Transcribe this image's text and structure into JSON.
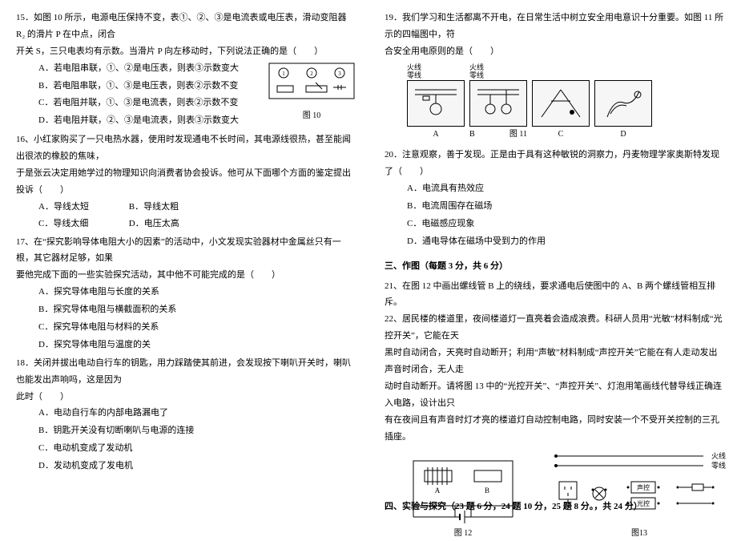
{
  "left": {
    "q15": {
      "stem1": "15．如图 10 所示，电源电压保持不变，表①、②、③是电流表或电压表，滑动变阻器 R₂ 的滑片 P 在中点，闭合",
      "stem2": "开关 S，三只电表均有示数。当滑片 P 向左移动时，下列说法正确的是（　　）",
      "A": "A．若电阻串联，①、②是电压表，则表③示数变大",
      "B": "B．若电阻串联，①、③是电压表，则表②示数不变",
      "C": "C．若电阻并联，①、③是电流表，则表②示数不变",
      "D": "D．若电阻并联，②、③是电流表，则表③示数变大",
      "figcap": "图 10"
    },
    "q16": {
      "stem1": "16、小红家购买了一只电热水器，使用时发现通电不长时间，其电源线很热，甚至能闻出很浓的橡胶的焦味，",
      "stem2": "于是张云决定用她学过的物理知识向消费者协会投诉。他可从下面哪个方面的鉴定提出投诉（　　）",
      "A": "A．导线太短",
      "B": "B．导线太粗",
      "C": "C．导线太细",
      "D": "D．电压太高"
    },
    "q17": {
      "stem1": "17、在“探究影响导体电阻大小的因素”的活动中，小文发现实验器材中金属丝只有一根，其它器材足够，如果",
      "stem2": "要他完成下面的一些实验探究活动，其中他不可能完成的是（　　）",
      "A": "A．探究导体电阻与长度的关系",
      "B": "B．探究导体电阻与横截面积的关系",
      "C": "C．探究导体电阻与材料的关系",
      "D": "D．探究导体电阻与温度的关"
    },
    "q18": {
      "stem1": "18．关闭并拔出电动自行车的钥匙，用力踩踏使其前进，会发现按下喇叭开关时，喇叭也能发出声响吗，这是因为",
      "stem2": "此时（　　）",
      "A": "A．电动自行车的内部电路漏电了",
      "B": "B．钥匙开关没有切断喇叭与电源的连接",
      "C": "C．电动机变成了发动机",
      "D": "D．发动机变成了发电机"
    }
  },
  "right": {
    "q19": {
      "stem1": "19．我们学习和生活都离不开电，在日常生活中树立安全用电意识十分重要。如图 11 所示的四幅图中，符",
      "stem2": "合安全用电原则的是（　　）",
      "labelA": "A",
      "labelB": "B",
      "labelC": "C",
      "labelD": "D",
      "wire1": "火线",
      "wire2": "零线",
      "figcap": "图 11"
    },
    "q20": {
      "stem": "20．注意观察，善于发现。正是由于具有这种敏锐的洞察力，丹麦物理学家奥斯特发现了（　　）",
      "A": "A．电流具有热效应",
      "B": "B．电流周围存在磁场",
      "C": "C．电磁感应现象",
      "D": "D．通电导体在磁场中受到力的作用"
    },
    "section3": {
      "title": "三、作图（每题 3 分，共 6 分）",
      "q21": "21、在图 12 中画出螺线管 B 上的绕线，要求通电后使图中的 A、B 两个螺线管相互排斥。",
      "q22a": "22、居民楼的楼道里，夜间楼道灯一直亮着会造成浪费。科研人员用“光敏”材料制成“光控开关”，它能在天",
      "q22b": "黑时自动闭合，天亮时自动断开；利用“声敏”材料制成“声控开关”它能在有人走动发出声音时闭合，无人走",
      "q22c": "动时自动断开。请将图 13 中的“光控开关”、“声控开关”、灯泡用笔画线代替导线正确连入电路，设计出只",
      "q22d": "有在夜间且有声音时灯才亮的楼道灯自动控制电路，同时安装一个不受开关控制的三孔插座。",
      "fig12cap": "图 12",
      "fig12A": "A",
      "fig12B": "B",
      "fig13cap": "图13",
      "fig13wire1": "火线",
      "fig13wire2": "零线",
      "fig13sound": "声控",
      "fig13light": "光控"
    },
    "section4": "四、实验与探究（23 题 6 分，24 题 10 分，25 题 8 分。，共 24 分）"
  }
}
